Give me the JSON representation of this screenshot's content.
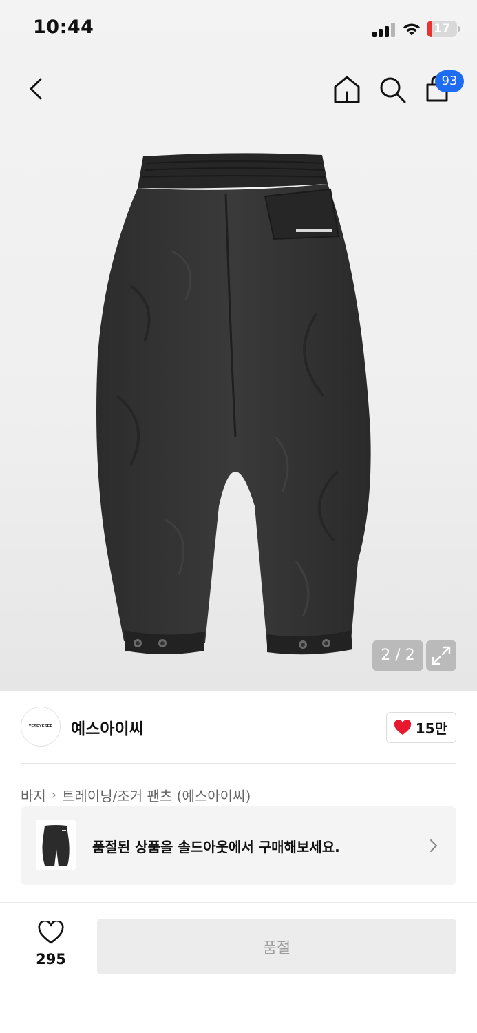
{
  "status_bar": {
    "time": "10:44",
    "battery_level": "17",
    "battery_fraction": 0.17,
    "battery_color": "#e8332f"
  },
  "nav": {
    "back_icon": "chevron-left-icon",
    "home_icon": "home-icon",
    "search_icon": "search-icon",
    "bag_icon": "shopping-bag-icon",
    "bag_count": "93",
    "badge_color": "#1e6cf1"
  },
  "gallery": {
    "counter": "2 / 2",
    "expand_icon": "expand-icon"
  },
  "brand": {
    "logo_text": "YESEYESEE",
    "name": "예스아이씨",
    "like_count": "15만",
    "heart_color": "#e8182f"
  },
  "breadcrumb": {
    "items": [
      "바지",
      "트레이닝/조거 팬츠 (예스아이씨)"
    ]
  },
  "soldout_banner": {
    "text": "품절된 상품을 솔드아웃에서 구매해보세요."
  },
  "bottom_bar": {
    "wish_count": "295",
    "buy_label": "품절"
  }
}
